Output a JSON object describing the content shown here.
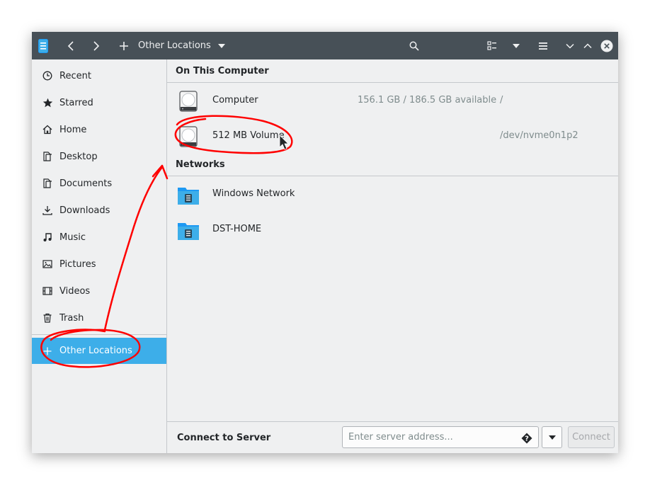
{
  "titlebar": {
    "location_label": "Other Locations",
    "icons": [
      "app-icon",
      "back-icon",
      "forward-icon",
      "add-icon",
      "dropdown-icon",
      "search-icon",
      "view-list-icon",
      "view-options-icon",
      "menu-icon",
      "minimize-icon",
      "maximize-icon",
      "close-icon"
    ]
  },
  "sidebar": {
    "items": [
      {
        "label": "Recent",
        "icon": "clock-icon"
      },
      {
        "label": "Starred",
        "icon": "star-icon"
      },
      {
        "label": "Home",
        "icon": "home-icon"
      },
      {
        "label": "Desktop",
        "icon": "desktop-icon"
      },
      {
        "label": "Documents",
        "icon": "documents-icon"
      },
      {
        "label": "Downloads",
        "icon": "downloads-icon"
      },
      {
        "label": "Music",
        "icon": "music-icon"
      },
      {
        "label": "Pictures",
        "icon": "pictures-icon"
      },
      {
        "label": "Videos",
        "icon": "videos-icon"
      },
      {
        "label": "Trash",
        "icon": "trash-icon"
      }
    ],
    "other_locations": {
      "label": "Other Locations",
      "icon": "plus-icon",
      "active": true
    }
  },
  "main": {
    "on_this_computer": {
      "heading": "On This Computer",
      "items": [
        {
          "name": "Computer",
          "info": "156.1 GB / 186.5 GB available",
          "path": "/",
          "icon": "drive-icon"
        },
        {
          "name": "512 MB Volume",
          "info": "",
          "path": "/dev/nvme0n1p2",
          "icon": "drive-icon"
        }
      ]
    },
    "networks": {
      "heading": "Networks",
      "items": [
        {
          "name": "Windows Network",
          "icon": "network-folder-icon"
        },
        {
          "name": "DST-HOME",
          "icon": "network-folder-icon"
        }
      ]
    }
  },
  "connect": {
    "label": "Connect to Server",
    "placeholder": "Enter server address...",
    "value": "",
    "button_label": "Connect"
  },
  "colors": {
    "titlebar": "#475057",
    "window_bg": "#eff0f1",
    "accent": "#3daee9",
    "annotation": "#ff0000"
  }
}
